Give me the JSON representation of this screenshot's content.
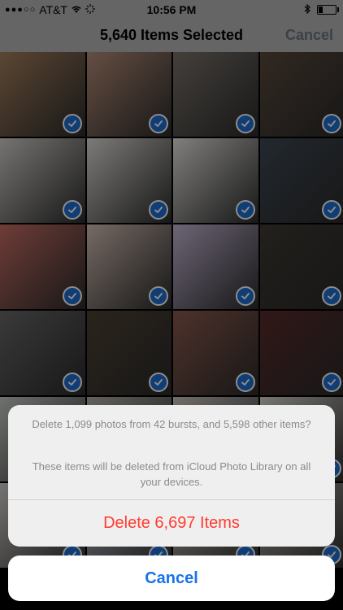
{
  "status_bar": {
    "signal": "●●●○○",
    "carrier": "AT&T",
    "time": "10:56 PM",
    "battery_level": 0.25
  },
  "nav": {
    "title": "5,640 Items Selected",
    "cancel_label": "Cancel"
  },
  "grid": {
    "tiles": [
      {
        "color": "#a7815e"
      },
      {
        "color": "#b88f7a"
      },
      {
        "color": "#7c746d"
      },
      {
        "color": "#5b4a3c"
      },
      {
        "color": "#d6d3cf"
      },
      {
        "color": "#e3e0db"
      },
      {
        "color": "#eae7e4"
      },
      {
        "color": "#3f4a55"
      },
      {
        "color": "#c96f66"
      },
      {
        "color": "#d7c1b6"
      },
      {
        "color": "#c7b8d6"
      },
      {
        "color": "#3f3a34"
      },
      {
        "color": "#6a6a6a"
      },
      {
        "color": "#4f4234"
      },
      {
        "color": "#8f5b4f"
      },
      {
        "color": "#5c2a2a"
      },
      {
        "color": "#c8cfc8"
      },
      {
        "color": "#b7b2a9"
      },
      {
        "color": "#cfc9c4"
      },
      {
        "color": "#dcd7d0"
      },
      {
        "color": "#d5d2cf"
      },
      {
        "color": "#bfc8d1"
      },
      {
        "color": "#cbc5be"
      },
      {
        "color": "#b9b4ad"
      }
    ],
    "check_color": "#1f6fd6"
  },
  "action_sheet": {
    "message_line1": "Delete 1,099 photos from 42 bursts, and 5,598 other items?",
    "message_line2": "These items will be deleted from iCloud Photo Library on all your devices.",
    "delete_label": "Delete 6,697 Items",
    "cancel_label": "Cancel",
    "delete_color": "#ff3b30",
    "cancel_color": "#1a73e8"
  }
}
